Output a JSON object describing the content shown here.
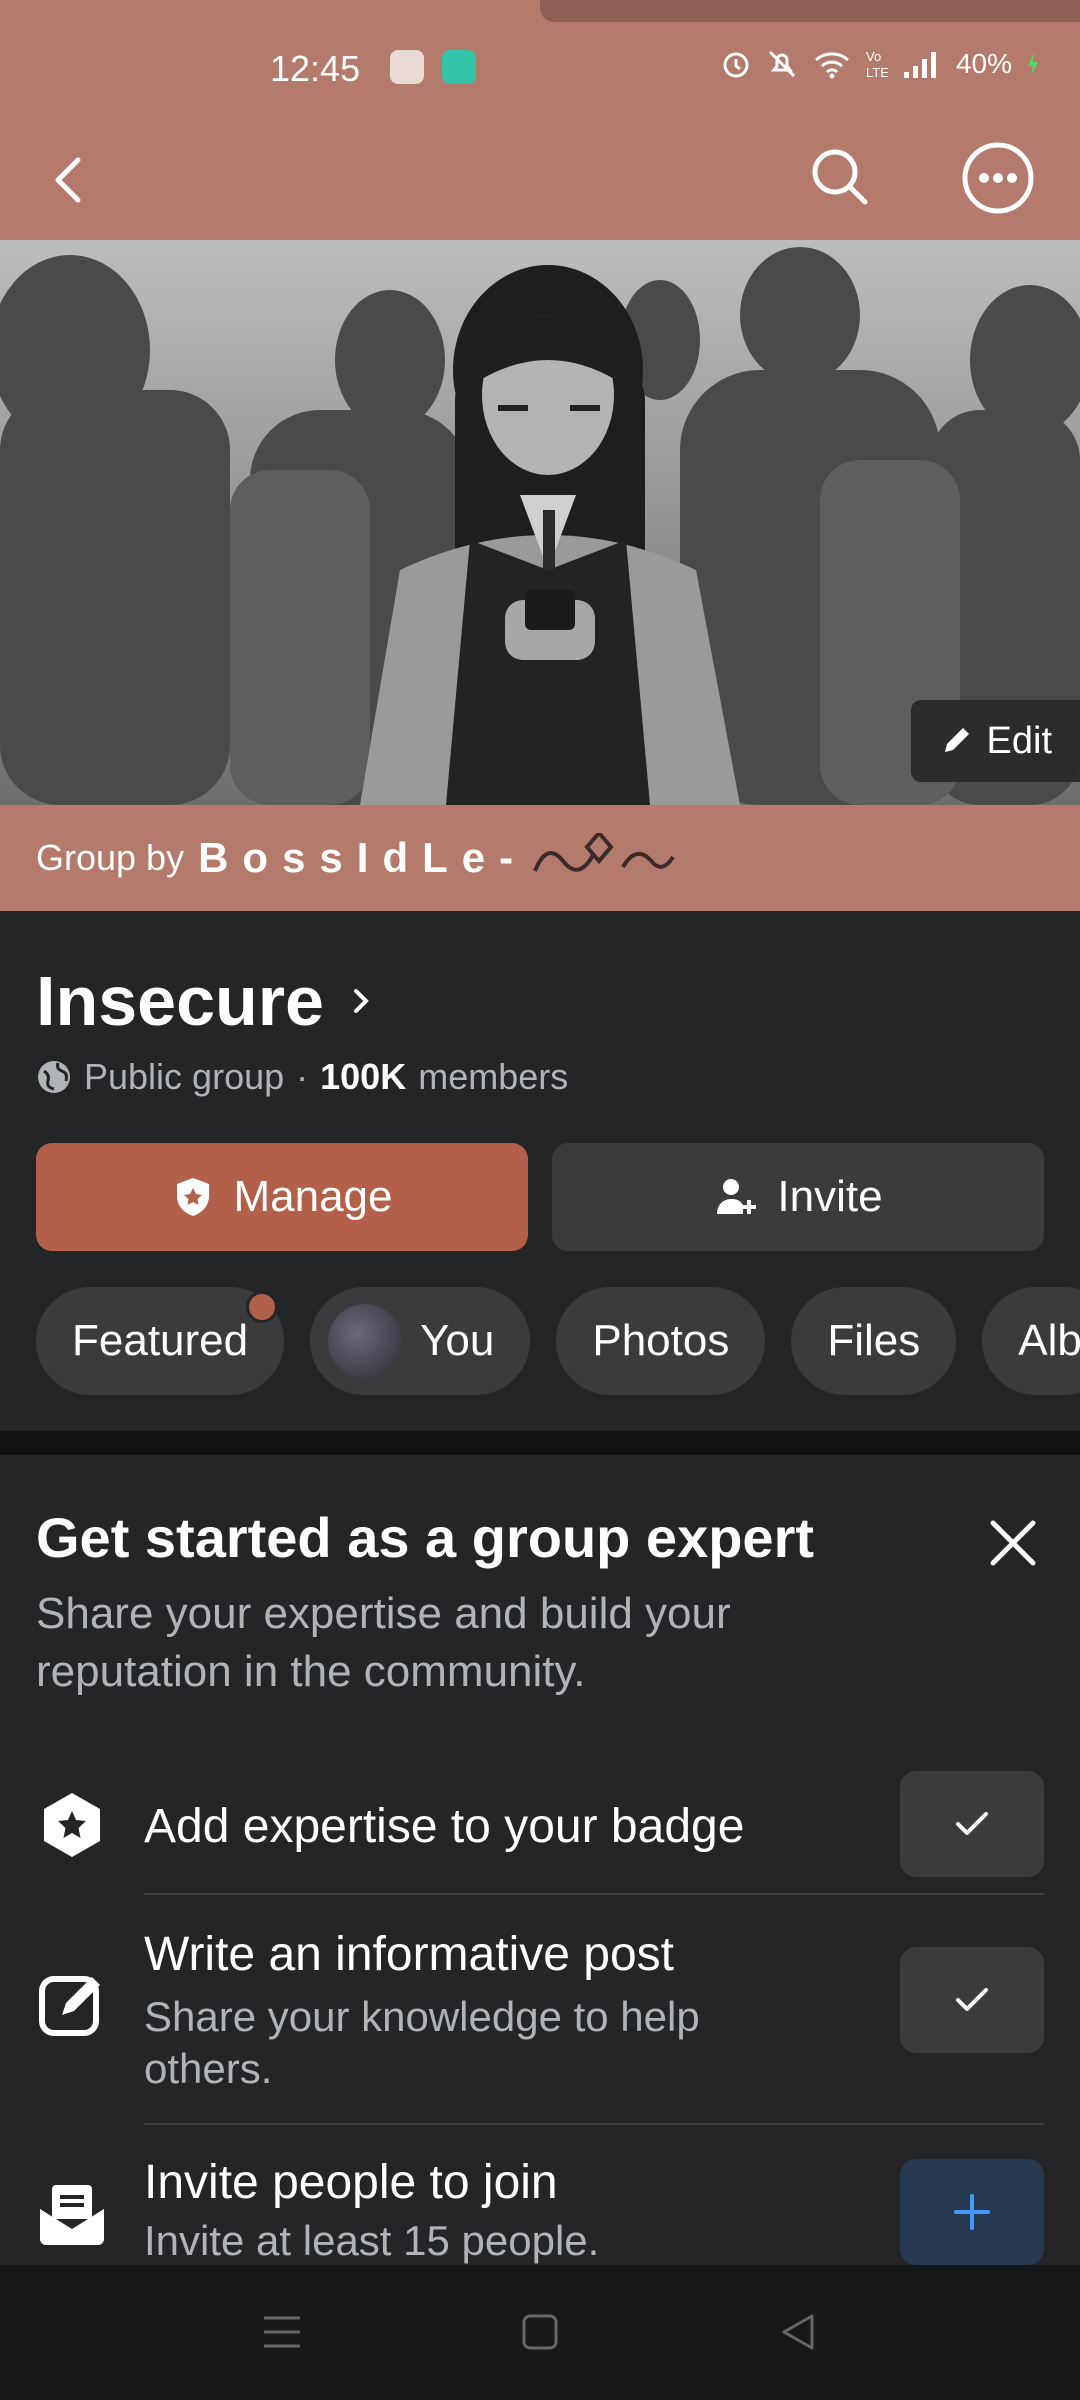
{
  "status_bar": {
    "time": "12:45",
    "battery": "40%",
    "icons": [
      "calendar-app-icon",
      "chat-app-icon",
      "alarm-icon",
      "mute-icon",
      "wifi-icon",
      "volte-icon",
      "signal-icon",
      "battery-charging-icon"
    ]
  },
  "topbar": {
    "icons": [
      "back-icon",
      "search-icon",
      "more-icon"
    ]
  },
  "cover": {
    "edit_label": "Edit"
  },
  "group_by": {
    "prefix": "Group by",
    "owner": "BossIdLe-"
  },
  "group": {
    "name": "Insecure",
    "privacy": "Public group",
    "separator": "·",
    "members_count": "100K",
    "members_label": "members"
  },
  "actions": {
    "manage": "Manage",
    "invite": "Invite"
  },
  "tabs": [
    {
      "label": "Featured"
    },
    {
      "label": "You"
    },
    {
      "label": "Photos"
    },
    {
      "label": "Files"
    },
    {
      "label": "Alb"
    }
  ],
  "expert_card": {
    "title": "Get started as a group expert",
    "subtitle": "Share your expertise and build your reputation in the community.",
    "tasks": [
      {
        "title": "Add expertise to your badge",
        "desc": "",
        "icon": "badge-star-icon",
        "action_icon": "check-icon"
      },
      {
        "title": "Write an informative post",
        "desc": "Share your knowledge to help others.",
        "icon": "edit-post-icon",
        "action_icon": "check-icon"
      },
      {
        "title": "Invite people to join",
        "desc": "Invite at least 15 people.",
        "icon": "invite-mail-icon",
        "action_icon": "plus-icon"
      }
    ]
  },
  "colors": {
    "accent": "#b47a6b",
    "manage_button": "#b3604a",
    "background": "#242526",
    "chip": "#3a3b3c",
    "plus_accent": "#4599ff"
  }
}
